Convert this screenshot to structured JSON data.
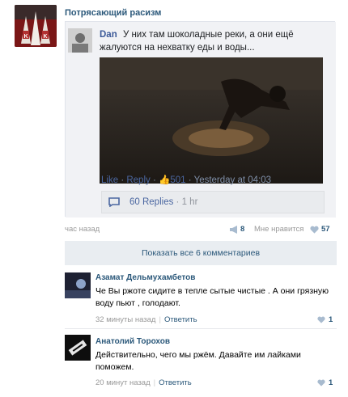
{
  "post": {
    "group_name": "Потрясающий расизм",
    "avatar_letters": "K K",
    "time": "час назад",
    "reposts": "8",
    "like_label": "Мне нравится",
    "likes": "57"
  },
  "embed": {
    "author": "Dan",
    "text": "У них там шоколадные реки, а они ещё жалуются на нехватку еды и воды...",
    "like_link": "Like",
    "sep": "·",
    "reply_link": "Reply",
    "likes_count": "501",
    "timestamp": "Yesterday at 04:03",
    "replies_label": "60 Replies",
    "replies_time": "1 hr"
  },
  "show_all_label": "Показать все 6 комментариев",
  "comments": [
    {
      "author": "Азамат Дельмухамбетов",
      "text": "Че Вы ржоте сидите в тепле сытые чистые . А они грязную воду пьют , голодают.",
      "time": "32 минуты назад",
      "reply": "Ответить",
      "likes": "1"
    },
    {
      "author": "Анатолий Торохов",
      "text": "Действительно, чего мы ржём. Давайте им лайками поможем.",
      "time": "20 минут назад",
      "reply": "Ответить",
      "likes": "1"
    }
  ],
  "colors": {
    "vk_link": "#2b587a",
    "fb_link": "#4b67a1",
    "meta_gray": "#999999"
  }
}
